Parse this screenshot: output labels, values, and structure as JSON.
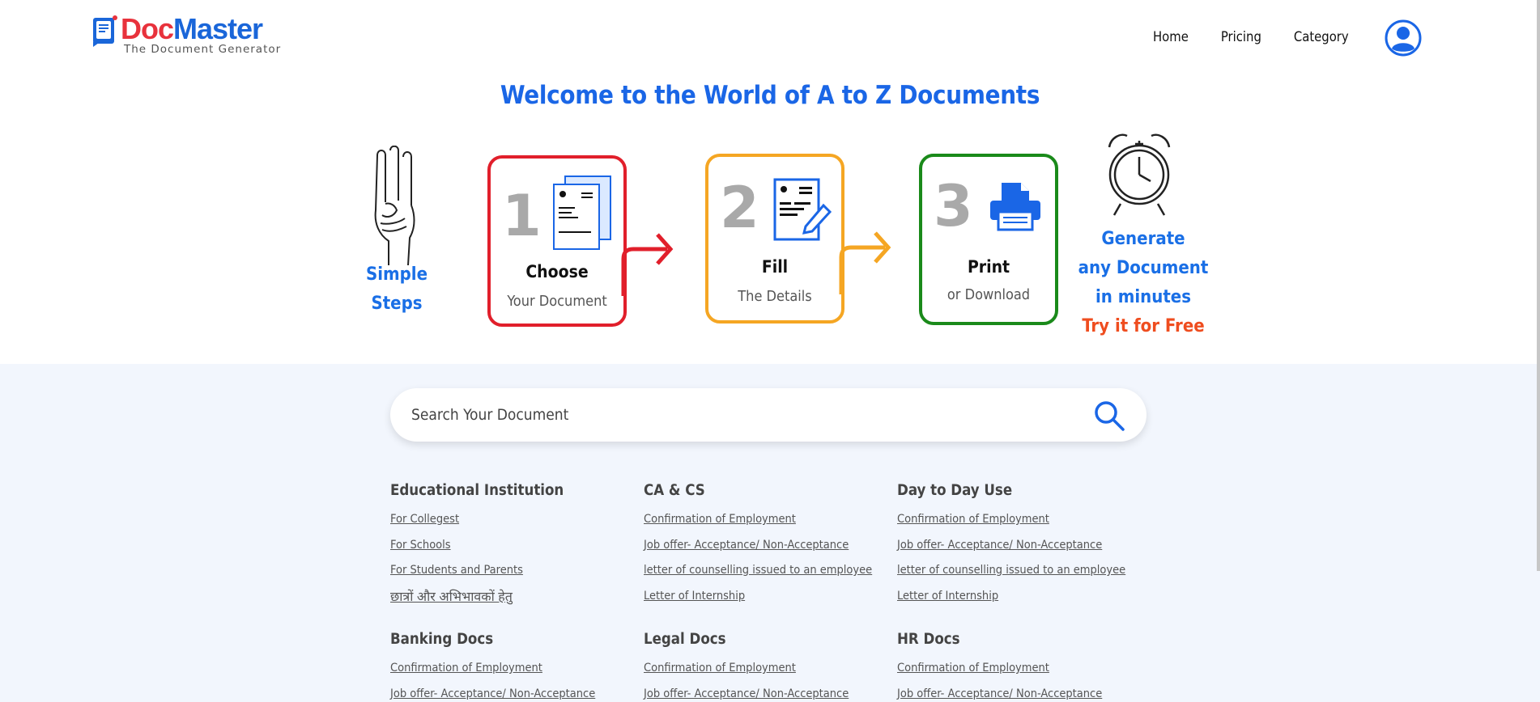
{
  "brand": {
    "name_part1": "Doc",
    "name_part2": "Master",
    "tagline": "The Document Generator",
    "colors": {
      "red": "#e8323c",
      "blue": "#1a66d9"
    }
  },
  "nav": {
    "items": [
      "Home",
      "Pricing",
      "Category"
    ],
    "profile_icon": "user-circle-icon"
  },
  "welcome": "Welcome to the World of A to Z Documents",
  "steps": {
    "intro_line1": "Simple",
    "intro_line2": "Steps",
    "cards": [
      {
        "number": "1",
        "label": "Choose",
        "sub": "Your Document",
        "color": "#e11f2b",
        "icon": "documents-icon"
      },
      {
        "number": "2",
        "label": "Fill",
        "sub": "The Details",
        "color": "#f5a623",
        "icon": "edit-document-icon"
      },
      {
        "number": "3",
        "label": "Print",
        "sub": "or Download",
        "color": "#1a8a1a",
        "icon": "printer-icon"
      }
    ],
    "cta_line1": "Generate",
    "cta_line2": "any Document",
    "cta_line3": "in minutes",
    "cta_free": "Try it for Free"
  },
  "search": {
    "placeholder": "Search Your Document"
  },
  "categories": [
    {
      "title": "Educational Institution",
      "links": [
        "For Collegest",
        "For Schools",
        "For Students and Parents",
        "छात्रों और अभिभावकों हेतु"
      ]
    },
    {
      "title": "CA & CS",
      "links": [
        "Confirmation of Employment",
        "Job offer- Acceptance/ Non-Acceptance",
        "letter of counselling issued to an employee",
        "Letter of Internship"
      ]
    },
    {
      "title": "Day to Day Use",
      "links": [
        "Confirmation of Employment",
        "Job offer- Acceptance/ Non-Acceptance",
        "letter of counselling issued to an employee",
        "Letter of Internship"
      ]
    },
    {
      "title": "Banking Docs",
      "links": [
        "Confirmation of Employment",
        "Job offer- Acceptance/ Non-Acceptance"
      ]
    },
    {
      "title": "Legal Docs",
      "links": [
        "Confirmation of Employment",
        "Job offer- Acceptance/ Non-Acceptance"
      ]
    },
    {
      "title": "HR Docs",
      "links": [
        "Confirmation of Employment",
        "Job offer- Acceptance/ Non-Acceptance"
      ]
    }
  ]
}
